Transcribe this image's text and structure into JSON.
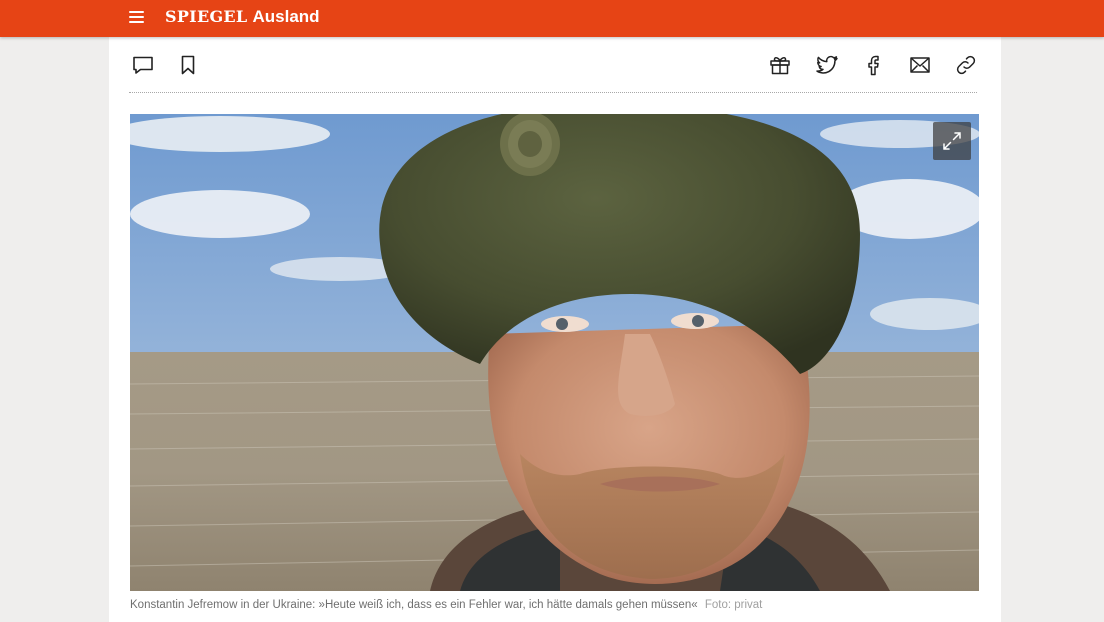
{
  "header": {
    "brand": "SPIEGEL",
    "section": "Ausland",
    "background_color": "#e64415",
    "menu_icon": "hamburger-menu-icon"
  },
  "toolbar": {
    "left_icons": [
      "comment-icon",
      "bookmark-icon"
    ],
    "right_icons": [
      "gift-icon",
      "twitter-icon",
      "facebook-icon",
      "mail-icon",
      "link-icon"
    ]
  },
  "article": {
    "image_alt": "Konstantin Jefremow in der Ukraine",
    "expand_icon": "expand-icon",
    "caption": "Konstantin Jefremow in der Ukraine: »Heute weiß ich, dass es ein Fehler war, ich hätte damals gehen müssen«",
    "credit": "Foto: privat"
  }
}
